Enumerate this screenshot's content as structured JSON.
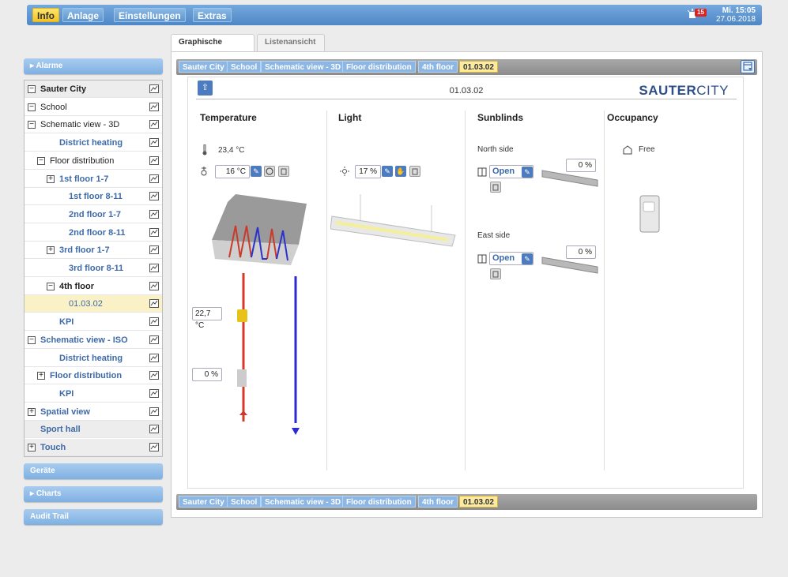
{
  "topmenu": [
    "Info",
    "Anlage",
    "Einstellungen",
    "Extras"
  ],
  "alarm_count": "15",
  "datetime": {
    "day_time": "Mi. 15:05",
    "date": "27.06.2018"
  },
  "sidebar": {
    "alarme": "Alarme",
    "geraete": "Geräte",
    "charts": "Charts",
    "audit_trail": "Audit Trail"
  },
  "tree": [
    {
      "label": "Sauter City",
      "level": 0,
      "toggle": "minus",
      "style": "dark",
      "bold": true,
      "bg": "gray"
    },
    {
      "label": "School",
      "level": 0,
      "toggle": "minus",
      "style": "dark",
      "bold": false,
      "bg": ""
    },
    {
      "label": "Schematic view - 3D",
      "level": 0,
      "toggle": "minus",
      "style": "dark",
      "bold": false,
      "bg": ""
    },
    {
      "label": "District heating",
      "level": 2,
      "toggle": "",
      "style": "link",
      "bold": true,
      "bg": ""
    },
    {
      "label": "Floor distribution",
      "level": 1,
      "toggle": "minus",
      "style": "dark",
      "bold": false,
      "bg": ""
    },
    {
      "label": "1st floor 1-7",
      "level": 2,
      "toggle": "plus",
      "style": "link",
      "bold": true,
      "bg": ""
    },
    {
      "label": "1st floor 8-11",
      "level": 3,
      "toggle": "",
      "style": "link",
      "bold": true,
      "bg": ""
    },
    {
      "label": "2nd floor 1-7",
      "level": 3,
      "toggle": "",
      "style": "link",
      "bold": true,
      "bg": ""
    },
    {
      "label": "2nd floor 8-11",
      "level": 3,
      "toggle": "",
      "style": "link",
      "bold": true,
      "bg": ""
    },
    {
      "label": "3rd floor 1-7",
      "level": 2,
      "toggle": "plus",
      "style": "link",
      "bold": true,
      "bg": ""
    },
    {
      "label": "3rd floor 8-11",
      "level": 3,
      "toggle": "",
      "style": "link",
      "bold": true,
      "bg": ""
    },
    {
      "label": "4th floor",
      "level": 2,
      "toggle": "minus",
      "style": "dark",
      "bold": true,
      "bg": ""
    },
    {
      "label": "01.03.02",
      "level": 3,
      "toggle": "",
      "style": "link",
      "bold": false,
      "bg": "sel"
    },
    {
      "label": "KPI",
      "level": 2,
      "toggle": "",
      "style": "link",
      "bold": true,
      "bg": ""
    },
    {
      "label": "Schematic view - ISO",
      "level": 0,
      "toggle": "minus",
      "style": "link",
      "bold": true,
      "bg": ""
    },
    {
      "label": "District heating",
      "level": 2,
      "toggle": "",
      "style": "link",
      "bold": true,
      "bg": ""
    },
    {
      "label": "Floor distribution",
      "level": 1,
      "toggle": "plus",
      "style": "link",
      "bold": true,
      "bg": ""
    },
    {
      "label": "KPI",
      "level": 2,
      "toggle": "",
      "style": "link",
      "bold": true,
      "bg": ""
    },
    {
      "label": "Spatial view",
      "level": 0,
      "toggle": "plus",
      "style": "link",
      "bold": true,
      "bg": ""
    },
    {
      "label": "Sport hall",
      "level": 0,
      "toggle": "",
      "style": "link",
      "bold": true,
      "bg": "gray"
    },
    {
      "label": "Touch",
      "level": 0,
      "toggle": "plus",
      "style": "link",
      "bold": true,
      "bg": "gray"
    }
  ],
  "tabs": [
    "Graphische Ansicht",
    "Listenansicht"
  ],
  "breadcrumb": [
    "Sauter City",
    "School",
    "Schematic view - 3D",
    "Floor distribution",
    "4th floor",
    "01.03.02"
  ],
  "room": {
    "title": "01.03.02",
    "brand_bold": "SAUTER",
    "brand_light": "CITY"
  },
  "columns": {
    "temperature": "Temperature",
    "light": "Light",
    "sunblinds": "Sunblinds",
    "occupancy": "Occupancy"
  },
  "temperature": {
    "actual": "23,4 °C",
    "setpoint": "16 °C",
    "flow_temp": "22,7 °C",
    "valve": "0 %"
  },
  "light": {
    "level": "17 %"
  },
  "sunblinds": {
    "north_label": "North side",
    "north_state": "Open",
    "north_pos": "0 %",
    "east_label": "East side",
    "east_state": "Open",
    "east_pos": "0 %"
  },
  "occupancy": {
    "state": "Free"
  },
  "colors": {
    "accent": "#4f87c6",
    "active_menu": "#f2c325",
    "brand": "#2d4e86"
  }
}
